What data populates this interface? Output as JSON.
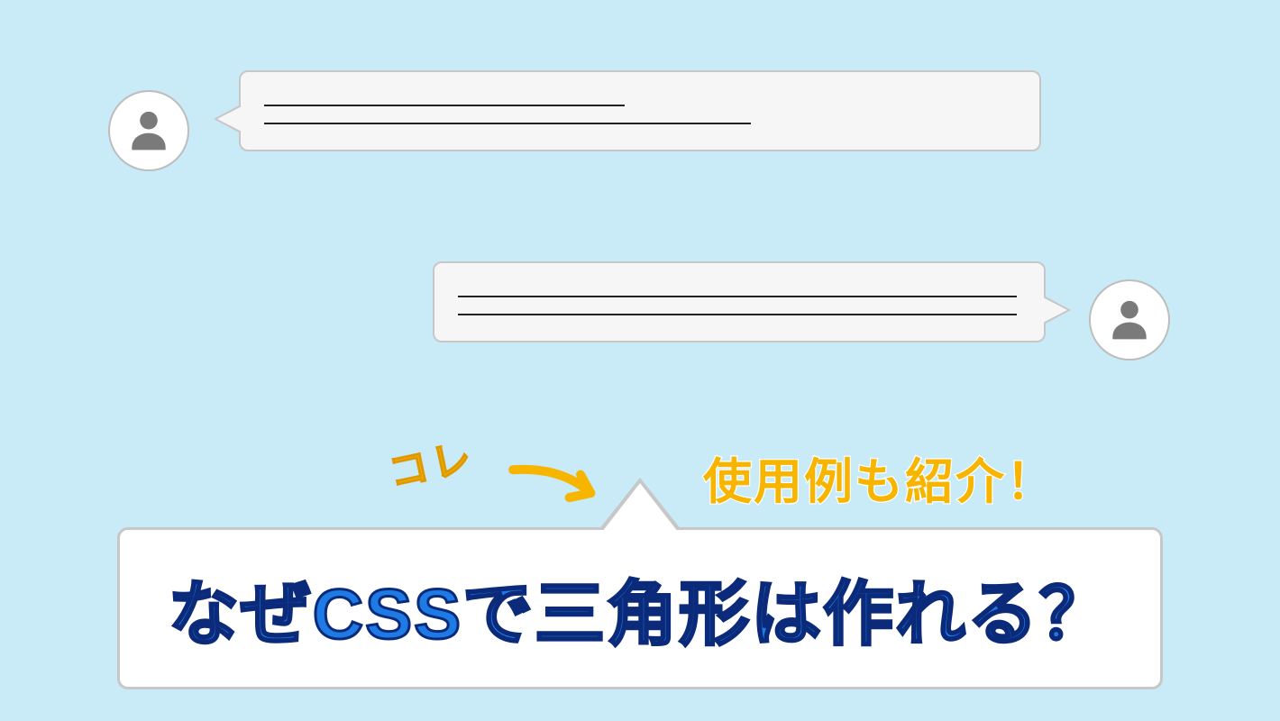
{
  "colors": {
    "background": "#C8EBF7",
    "bubble_fill": "#F6F6F6",
    "bubble_border": "#C7C7C7",
    "avatar_fill": "#7A7A7A",
    "accent_yellow": "#F7B500",
    "headline_fill": "#1E7BE5",
    "headline_stroke": "#0B2A7A"
  },
  "annotation": {
    "pointer_label": "コレ",
    "subtitle": "使用例も紹介！"
  },
  "headline": {
    "text": "なぜCSSで三角形は作れる？"
  }
}
